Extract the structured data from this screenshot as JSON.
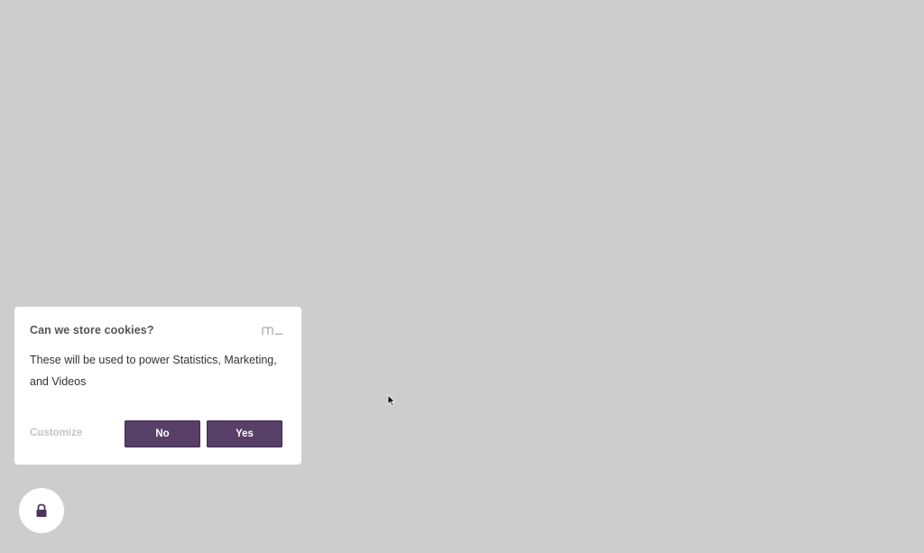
{
  "cookie_dialog": {
    "title": "Can we store cookies?",
    "body": "These will be used to power Statistics, Marketing, and Videos",
    "customize_label": "Customize",
    "no_label": "No",
    "yes_label": "Yes",
    "logo_icon": "m-logo-icon"
  },
  "privacy_button": {
    "icon": "lock-icon"
  },
  "colors": {
    "background": "#cdcdcd",
    "dialog": "#ffffff",
    "button": "#573f67",
    "button_text": "#ffffff",
    "customize": "#c4c4c4"
  }
}
